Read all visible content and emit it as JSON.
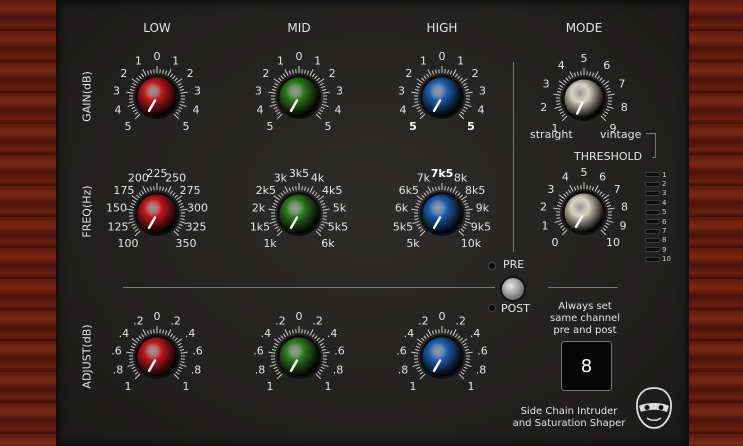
{
  "plugin": {
    "name_line1": "Side Chain Intruder",
    "name_line2": "and Saturation Shaper"
  },
  "columns": {
    "low": "LOW",
    "mid": "MID",
    "high": "HIGH",
    "mode": "MODE"
  },
  "row_labels": {
    "gain": "GAIN(dB)",
    "freq": "FREQ(Hz)",
    "adjust": "ADJUST(dB)"
  },
  "gain_scale": [
    "5",
    "4",
    "3",
    "2",
    "1",
    "0",
    "1",
    "2",
    "3",
    "4",
    "5"
  ],
  "low_freq_scale": [
    "100",
    "125",
    "150",
    "175",
    "200",
    "225",
    "250",
    "275",
    "300",
    "325",
    "350"
  ],
  "mid_freq_scale": [
    "1k",
    "1k5",
    "2k",
    "2k5",
    "3k",
    "3k5",
    "4k",
    "4k5",
    "5k",
    "5k5",
    "6k"
  ],
  "high_freq_scale": [
    "5k",
    "5k5",
    "6k",
    "6k5",
    "7k",
    "7k5",
    "8k",
    "8k5",
    "9k",
    "9k5",
    "10k"
  ],
  "adjust_scale": [
    "1",
    ".8",
    ".6",
    ".4",
    ".2",
    "0",
    ".2",
    ".4",
    ".6",
    ".8",
    "1"
  ],
  "mode_scale": [
    "1",
    "2",
    "3",
    "4",
    "5",
    "6",
    "7",
    "8",
    "9"
  ],
  "mode_left_label": "straight",
  "mode_right_label": "vintage",
  "threshold": {
    "label": "THRESHOLD",
    "scale": [
      "0",
      "1",
      "2",
      "3",
      "4",
      "5",
      "6",
      "7",
      "8",
      "9",
      "10"
    ]
  },
  "meter_scale": [
    "1",
    "2",
    "3",
    "4",
    "5",
    "6",
    "7",
    "8",
    "9",
    "10"
  ],
  "prepost": {
    "pre": "PRE",
    "post": "POST",
    "note": [
      "Always set",
      "same channel",
      "pre and post"
    ],
    "channel_value": "8"
  },
  "colors": {
    "low": "#c0181c",
    "mid": "#2e7a1e",
    "high": "#1e5fb0",
    "cream": "#d8d4c0"
  }
}
